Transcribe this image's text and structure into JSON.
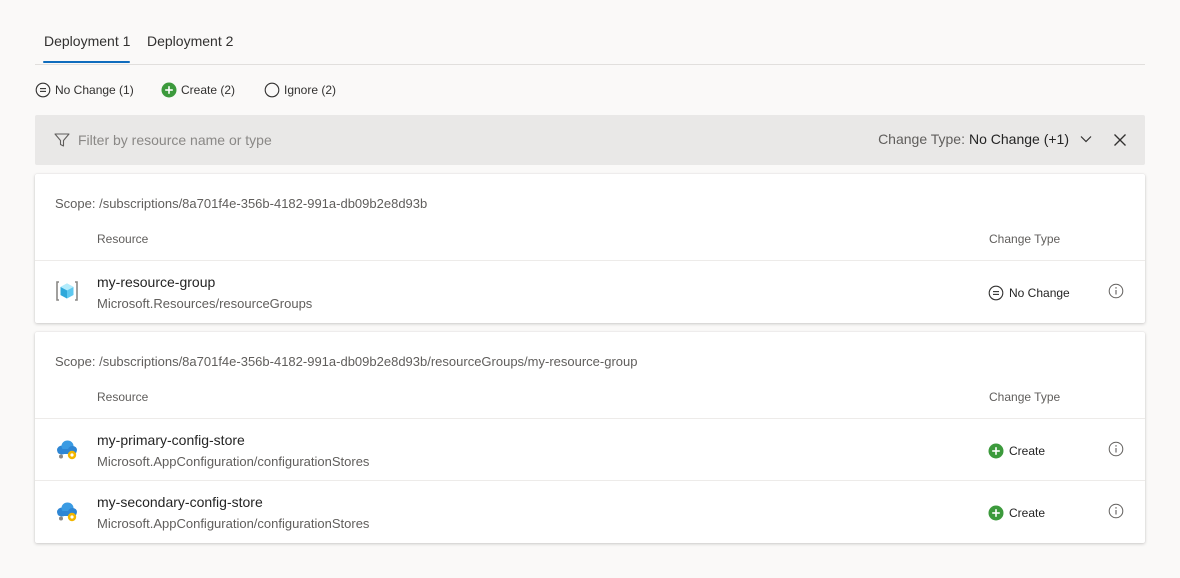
{
  "tabs": [
    {
      "label": "Deployment 1",
      "selected": true
    },
    {
      "label": "Deployment 2",
      "selected": false
    }
  ],
  "change_pills": [
    {
      "icon": "no-change-icon",
      "label": "No Change (1)"
    },
    {
      "icon": "create-icon",
      "label": "Create (2)"
    },
    {
      "icon": "ignore-icon",
      "label": "Ignore (2)"
    }
  ],
  "filter": {
    "placeholder": "Filter by resource name or type",
    "value": "",
    "change_type_label": "Change Type:",
    "change_type_value": "No Change (+1)"
  },
  "columns": {
    "resource": "Resource",
    "change_type": "Change Type"
  },
  "groups": [
    {
      "scope": "Scope: /subscriptions/8a701f4e-356b-4182-991a-db09b2e8d93b",
      "rows": [
        {
          "icon": "resource-group-icon",
          "name": "my-resource-group",
          "type": "Microsoft.Resources/resourceGroups",
          "change": "No Change",
          "change_icon": "no-change-icon"
        }
      ]
    },
    {
      "scope": "Scope: /subscriptions/8a701f4e-356b-4182-991a-db09b2e8d93b/resourceGroups/my-resource-group",
      "rows": [
        {
          "icon": "app-configuration-icon",
          "name": "my-primary-config-store",
          "type": "Microsoft.AppConfiguration/configurationStores",
          "change": "Create",
          "change_icon": "create-icon"
        },
        {
          "icon": "app-configuration-icon",
          "name": "my-secondary-config-store",
          "type": "Microsoft.AppConfiguration/configurationStores",
          "change": "Create",
          "change_icon": "create-icon"
        }
      ]
    }
  ],
  "colors": {
    "accent": "#0f6cbd",
    "create_green": "#3c9a3c",
    "filter_bar_bg": "#e9e8e7",
    "page_bg": "#faf9f8"
  }
}
